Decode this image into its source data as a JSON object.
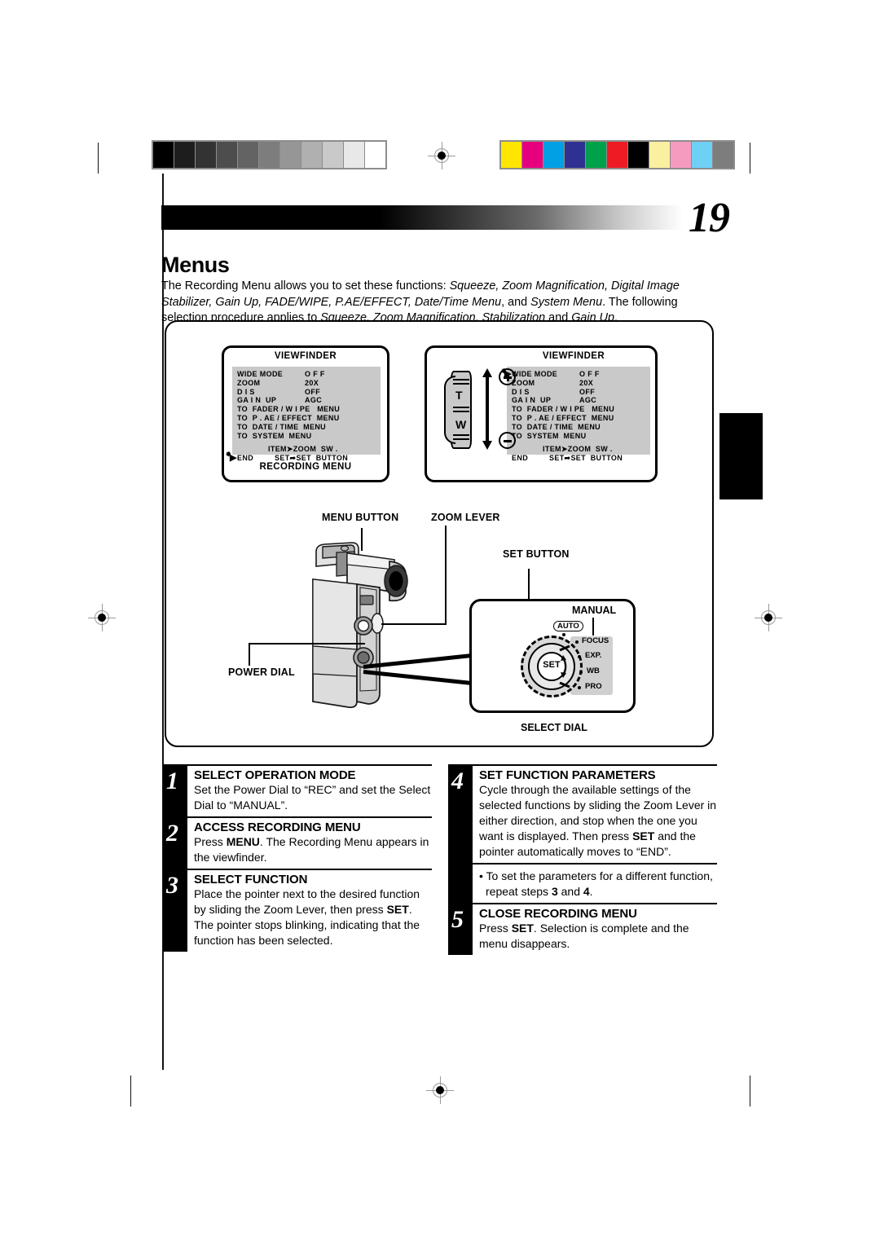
{
  "page": {
    "number": "19",
    "title": "Menus",
    "intro_parts": [
      {
        "t": "The Recording Menu allows you to set these functions: ",
        "i": false
      },
      {
        "t": "Squeeze, Zoom Magnification, Digital Image Stabilizer, Gain Up, FADE/WIPE, P.AE/EFFECT, Date/Time Menu",
        "i": true
      },
      {
        "t": ", and ",
        "i": false
      },
      {
        "t": "System Menu",
        "i": true
      },
      {
        "t": ". The following selection procedure applies to ",
        "i": false
      },
      {
        "t": "Squeeze, Zoom Magnification, Stabilization",
        "i": true
      },
      {
        "t": " and ",
        "i": false
      },
      {
        "t": "Gain Up",
        "i": true
      },
      {
        "t": ".",
        "i": false
      }
    ]
  },
  "calibration": {
    "grayscale": [
      "#000000",
      "#1d1d1d",
      "#333333",
      "#4d4d4d",
      "#636363",
      "#7d7d7d",
      "#969696",
      "#b0b0b0",
      "#c9c9c9",
      "#e8e8e8",
      "#ffffff"
    ],
    "colors": [
      "#ffe600",
      "#e6007e",
      "#00a0e4",
      "#2e3192",
      "#00a14b",
      "#ed1c24",
      "#000000",
      "#fbf0a0",
      "#f59bc0",
      "#6fd0f5",
      "#7d7d7d"
    ]
  },
  "viewfinder_1": {
    "title": "VIEWFINDER",
    "caption": "RECORDING MENU",
    "items": [
      {
        "label": "WIDE MODE",
        "value": "O F F"
      },
      {
        "label": "ZOOM",
        "value": "20X"
      },
      {
        "label": "D I S",
        "value": "OFF"
      },
      {
        "label": "GA I N  UP",
        "value": "AGC"
      },
      {
        "label": "TO  FADER / W I PE   MENU",
        "value": ""
      },
      {
        "label": "TO  P . AE / EFFECT  MENU",
        "value": ""
      },
      {
        "label": "TO  DATE / TIME  MENU",
        "value": ""
      },
      {
        "label": "TO  SYSTEM  MENU",
        "value": ""
      }
    ],
    "footer_line1": "ITEM➤ZOOM  SW .",
    "footer_line2": "SET➦SET  BUTTON",
    "end_label": "END",
    "pointer_on": "END"
  },
  "viewfinder_2": {
    "title": "VIEWFINDER",
    "items": [
      {
        "label": "WIDE MODE",
        "value": "O F F"
      },
      {
        "label": "ZOOM",
        "value": "20X"
      },
      {
        "label": "D I S",
        "value": "OFF"
      },
      {
        "label": "GA I N  UP",
        "value": "AGC"
      },
      {
        "label": "TO  FADER / W I PE   MENU",
        "value": ""
      },
      {
        "label": "TO  P . AE / EFFECT  MENU",
        "value": ""
      },
      {
        "label": "TO  DATE / TIME  MENU",
        "value": ""
      },
      {
        "label": "TO  SYSTEM  MENU",
        "value": ""
      }
    ],
    "footer_line1": "ITEM➤ZOOM  SW .",
    "footer_line2": "SET➦SET  BUTTON",
    "end_label": "END",
    "pointer_on": "WIDE MODE",
    "lever": {
      "tele": "T",
      "wide": "W",
      "plus": "+",
      "minus": "−"
    }
  },
  "callouts": {
    "menu_button": "MENU BUTTON",
    "zoom_lever": "ZOOM LEVER",
    "power_dial": "POWER DIAL",
    "set_button": "SET BUTTON",
    "select_dial": "SELECT DIAL",
    "manual": "MANUAL",
    "auto": "AUTO",
    "set_center": "SET",
    "dial_options": [
      "FOCUS",
      "EXP.",
      "WB",
      "PRO"
    ]
  },
  "steps_left": [
    {
      "num": "1",
      "title": "SELECT OPERATION MODE",
      "body": [
        {
          "t": "Set the Power Dial to “REC” and set the Select Dial to “MANUAL”.",
          "b": false
        }
      ]
    },
    {
      "num": "2",
      "title": "ACCESS RECORDING MENU",
      "body": [
        {
          "t": "Press ",
          "b": false
        },
        {
          "t": "MENU",
          "b": true
        },
        {
          "t": ". The Recording Menu appears in the viewfinder.",
          "b": false
        }
      ]
    },
    {
      "num": "3",
      "title": "SELECT FUNCTION",
      "body": [
        {
          "t": "Place the pointer next to the desired function by sliding the Zoom Lever, then press ",
          "b": false
        },
        {
          "t": "SET",
          "b": true
        },
        {
          "t": ". The pointer stops blinking, indicating that the function has been selected.",
          "b": false
        }
      ]
    }
  ],
  "steps_right": [
    {
      "num": "4",
      "title": "SET FUNCTION PARAMETERS",
      "body": [
        {
          "t": "Cycle through the available settings of the selected functions by sliding the Zoom Lever in either direction, and stop when the one you want is displayed. Then press ",
          "b": false
        },
        {
          "t": "SET",
          "b": true
        },
        {
          "t": " and the pointer automatically moves to “END”.",
          "b": false
        }
      ]
    }
  ],
  "note": {
    "bullet": "•",
    "body": [
      {
        "t": "To set the parameters for a different function, repeat steps ",
        "b": false
      },
      {
        "t": "3",
        "b": true
      },
      {
        "t": " and ",
        "b": false
      },
      {
        "t": "4",
        "b": true
      },
      {
        "t": ".",
        "b": false
      }
    ]
  },
  "steps_right_2": [
    {
      "num": "5",
      "title": "CLOSE RECORDING MENU",
      "body": [
        {
          "t": "Press ",
          "b": false
        },
        {
          "t": "SET",
          "b": true
        },
        {
          "t": ". Selection is complete and the menu disappears.",
          "b": false
        }
      ]
    }
  ]
}
